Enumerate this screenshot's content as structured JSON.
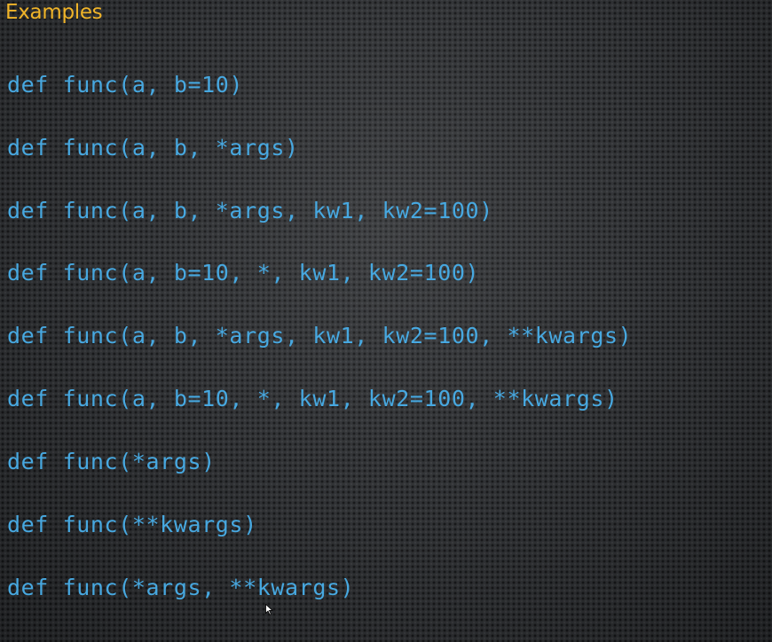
{
  "slide": {
    "title": "Examples",
    "title_color": "#f0b429",
    "code_color": "#47a8e0",
    "lines": [
      "def func(a, b=10)",
      "def func(a, b, *args)",
      "def func(a, b, *args, kw1, kw2=100)",
      "def func(a, b=10, *, kw1, kw2=100)",
      "def func(a, b, *args, kw1, kw2=100, **kwargs)",
      "def func(a, b=10, *, kw1, kw2=100, **kwargs)",
      "def func(*args)",
      "def func(**kwargs)",
      "def func(*args, **kwargs)"
    ]
  },
  "cursor": {
    "icon": "mouse-pointer-icon"
  }
}
